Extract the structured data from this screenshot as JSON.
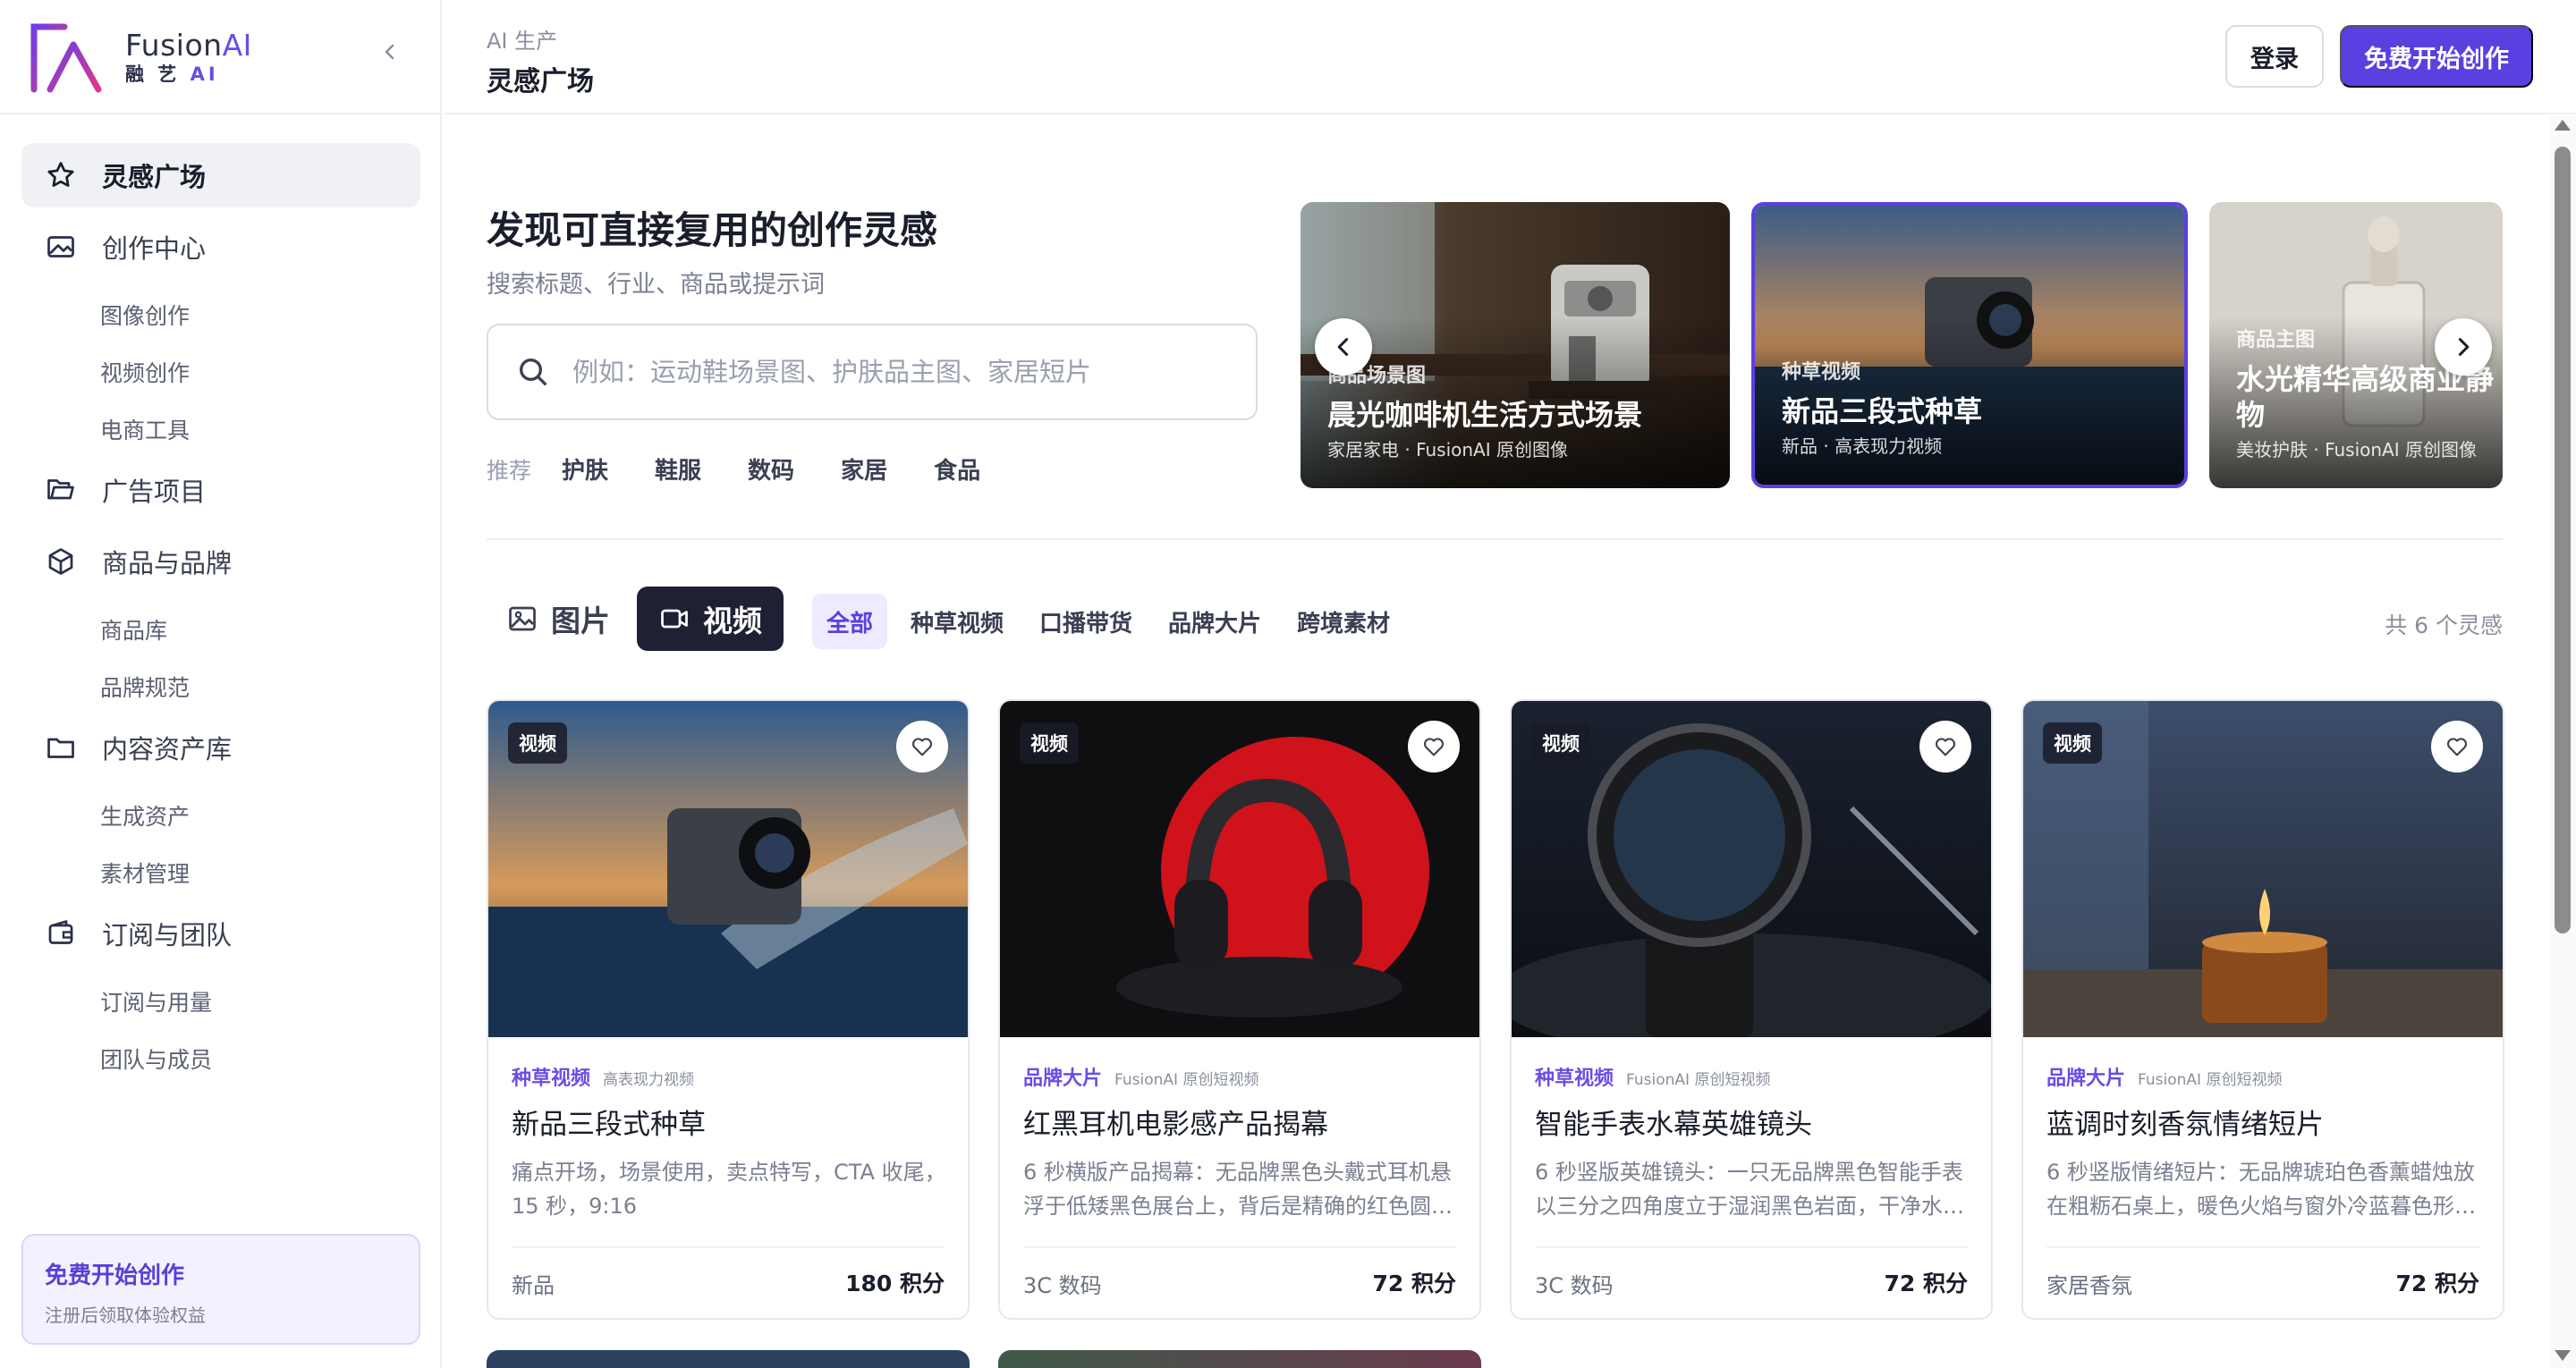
{
  "brand": {
    "name_main": "Fusion",
    "name_ai": "AI",
    "sub_main": "融 艺 ",
    "sub_ai": "AI"
  },
  "sidebar": {
    "nav": [
      {
        "label": "灵感广场",
        "icon": "star-icon",
        "active": true
      },
      {
        "label": "创作中心",
        "icon": "image-icon"
      },
      {
        "label": "图像创作",
        "sub": true
      },
      {
        "label": "视频创作",
        "sub": true
      },
      {
        "label": "电商工具",
        "sub": true
      },
      {
        "label": "广告项目",
        "icon": "folder-open-icon"
      },
      {
        "label": "商品与品牌",
        "icon": "box-icon"
      },
      {
        "label": "商品库",
        "sub": true
      },
      {
        "label": "品牌规范",
        "sub": true
      },
      {
        "label": "内容资产库",
        "icon": "folder-icon"
      },
      {
        "label": "生成资产",
        "sub": true
      },
      {
        "label": "素材管理",
        "sub": true
      },
      {
        "label": "订阅与团队",
        "icon": "wallet-icon"
      },
      {
        "label": "订阅与用量",
        "sub": true
      },
      {
        "label": "团队与成员",
        "sub": true
      }
    ],
    "promo": {
      "title": "免费开始创作",
      "subtitle": "注册后领取体验权益"
    }
  },
  "header": {
    "breadcrumb": "AI 生产",
    "title": "灵感广场",
    "login_label": "登录",
    "start_label": "免费开始创作"
  },
  "hero": {
    "title": "发现可直接复用的创作灵感",
    "subtitle": "搜索标题、行业、商品或提示词",
    "search_placeholder": "例如：运动鞋场景图、护肤品主图、家居短片",
    "recommend_label": "推荐",
    "recommend_tags": [
      "护肤",
      "鞋服",
      "数码",
      "家居",
      "食品"
    ]
  },
  "carousel": [
    {
      "category": "商品场景图",
      "title": "晨光咖啡机生活方式场景",
      "meta": "家居家电 · FusionAI 原创图像"
    },
    {
      "category": "种草视频",
      "title": "新品三段式种草",
      "meta": "新品 · 高表现力视频"
    },
    {
      "category": "商品主图",
      "title": "水光精华高级商业静物",
      "meta": "美妆护肤 · FusionAI 原创图像"
    }
  ],
  "filters": {
    "media_tabs": [
      {
        "label": "图片",
        "icon": "image-icon",
        "active": false
      },
      {
        "label": "视频",
        "icon": "video-camera-icon",
        "active": true
      }
    ],
    "chips": [
      {
        "label": "全部",
        "active": true
      },
      {
        "label": "种草视频"
      },
      {
        "label": "口播带货"
      },
      {
        "label": "品牌大片"
      },
      {
        "label": "跨境素材"
      }
    ],
    "count_text": "共 6 个灵感"
  },
  "cards": [
    {
      "badge": "视频",
      "category": "种草视频",
      "tagline": "高表现力视频",
      "title": "新品三段式种草",
      "desc": "痛点开场，场景使用，卖点特写，CTA 收尾，15 秒，9:16",
      "industry": "新品",
      "points": "180 积分"
    },
    {
      "badge": "视频",
      "category": "品牌大片",
      "tagline": "FusionAI 原创短视频",
      "title": "红黑耳机电影感产品揭幕",
      "desc": "6 秒横版产品揭幕：无品牌黑色头戴式耳机悬浮于低矮黑色展台上，背后是精确的红色圆…",
      "industry": "3C 数码",
      "points": "72 积分"
    },
    {
      "badge": "视频",
      "category": "种草视频",
      "tagline": "FusionAI 原创短视频",
      "title": "智能手表水幕英雄镜头",
      "desc": "6 秒竖版英雄镜头：一只无品牌黑色智能手表以三分之四角度立于湿润黑色岩面，干净水…",
      "industry": "3C 数码",
      "points": "72 积分"
    },
    {
      "badge": "视频",
      "category": "品牌大片",
      "tagline": "FusionAI 原创短视频",
      "title": "蓝调时刻香氛情绪短片",
      "desc": "6 秒竖版情绪短片：无品牌琥珀色香薰蜡烛放在粗粝石桌上，暖色火焰与窗外冷蓝暮色形…",
      "industry": "家居香氛",
      "points": "72 积分"
    }
  ]
}
